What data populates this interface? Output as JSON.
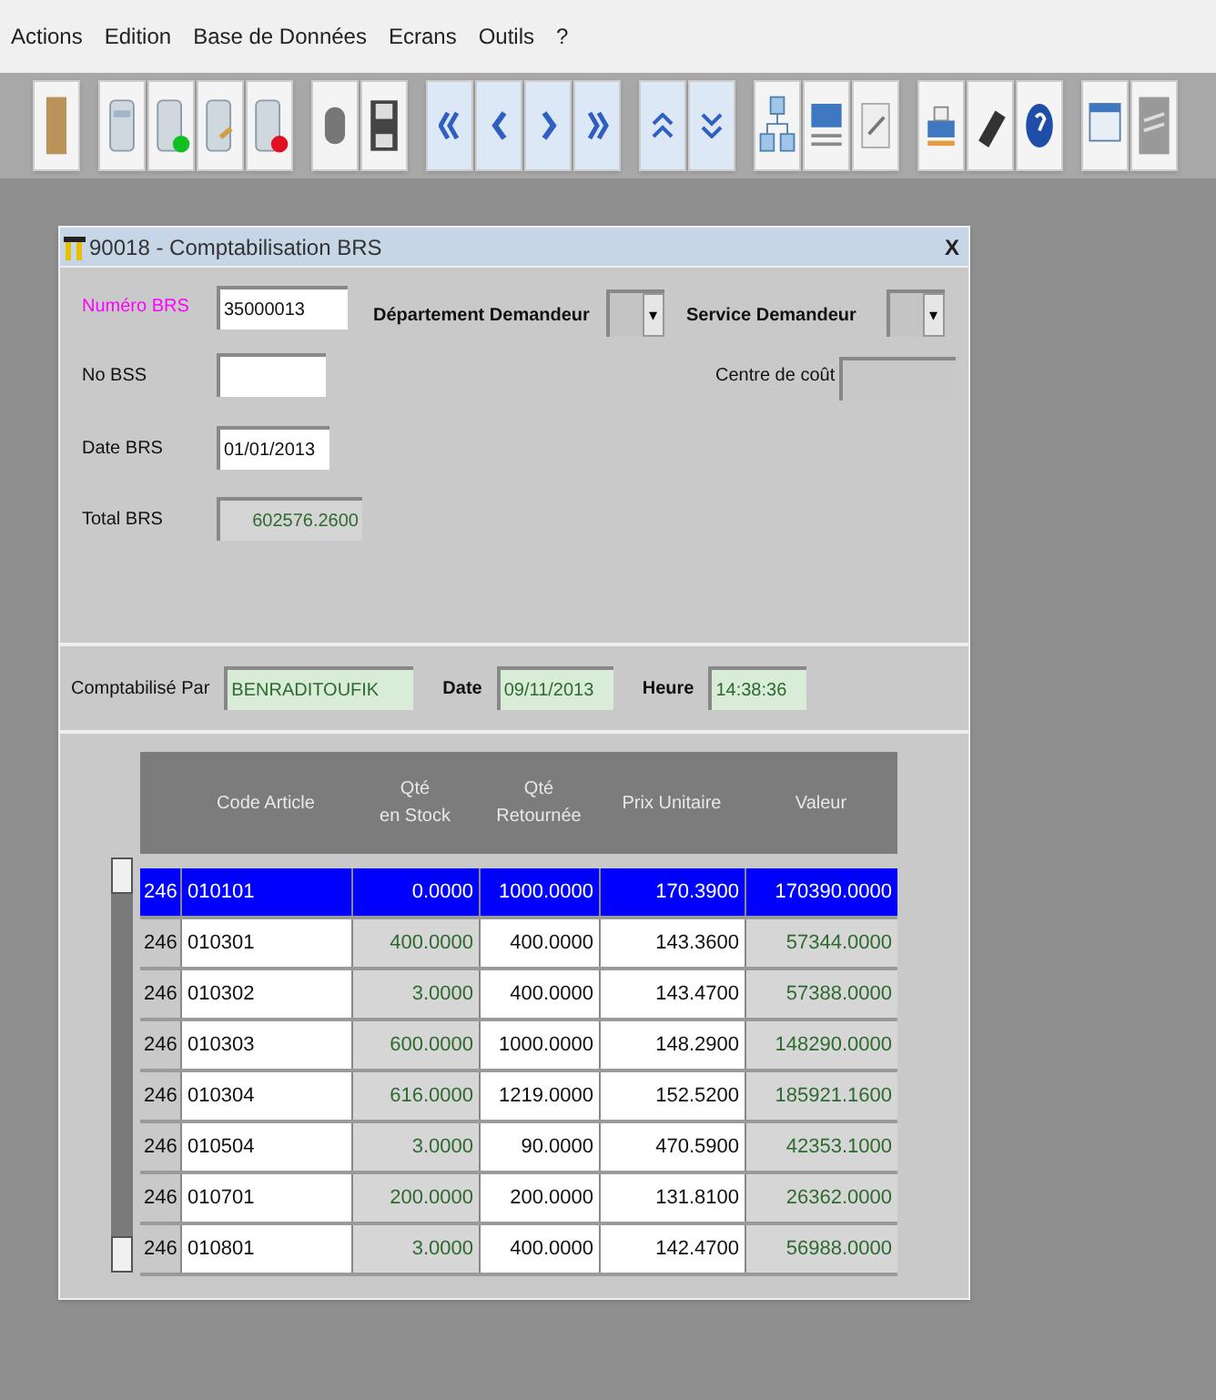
{
  "menu": [
    "Actions",
    "Edition",
    "Base de Données",
    "Ecrans",
    "Outils",
    "?"
  ],
  "window": {
    "title": "90018 - Comptabilisation BRS",
    "close": "X"
  },
  "form": {
    "numero_brs": {
      "label": "Numéro BRS",
      "value": "35000013"
    },
    "departement": {
      "label": "Département Demandeur",
      "button": "▾"
    },
    "service": {
      "label": "Service Demandeur",
      "button": "▾"
    },
    "no_bss": {
      "label": "No BSS"
    },
    "centre": {
      "label": "Centre de coût"
    },
    "date_brs": {
      "label": "Date BRS",
      "value": "01/01/2013"
    },
    "total_brs": {
      "label": "Total BRS",
      "value": "602576.2600"
    }
  },
  "posting": {
    "par": {
      "label": "Comptabilisé Par",
      "value": "BENRADITOUFIK"
    },
    "date": {
      "label": "Date",
      "value": "09/11/2013"
    },
    "heure": {
      "label": "Heure",
      "value": "14:38:36"
    }
  },
  "table": {
    "columns": [
      "Code Article",
      "Qté\nen Stock",
      "Qté\nRetournée",
      "Prix Unitaire",
      "Valeur"
    ],
    "rows": [
      {
        "prefix": "246",
        "cells": [
          "010101",
          "0.0000",
          "1000.0000",
          "170.3900",
          "170390.0000"
        ],
        "selected": true
      },
      {
        "prefix": "246",
        "cells": [
          "010301",
          "400.0000",
          "400.0000",
          "143.3600",
          "57344.0000"
        ],
        "selected": false
      },
      {
        "prefix": "246",
        "cells": [
          "010302",
          "3.0000",
          "400.0000",
          "143.4700",
          "57388.0000"
        ],
        "selected": false
      },
      {
        "prefix": "246",
        "cells": [
          "010303",
          "600.0000",
          "1000.0000",
          "148.2900",
          "148290.0000"
        ],
        "selected": false
      },
      {
        "prefix": "246",
        "cells": [
          "010304",
          "616.0000",
          "1219.0000",
          "152.5200",
          "185921.1600"
        ],
        "selected": false
      },
      {
        "prefix": "246",
        "cells": [
          "010504",
          "3.0000",
          "90.0000",
          "470.5900",
          "42353.1000"
        ],
        "selected": false
      },
      {
        "prefix": "246",
        "cells": [
          "010701",
          "200.0000",
          "200.0000",
          "131.8100",
          "26362.0000"
        ],
        "selected": false
      },
      {
        "prefix": "246",
        "cells": [
          "010801",
          "3.0000",
          "400.0000",
          "142.4700",
          "56988.0000"
        ],
        "selected": false
      }
    ]
  }
}
